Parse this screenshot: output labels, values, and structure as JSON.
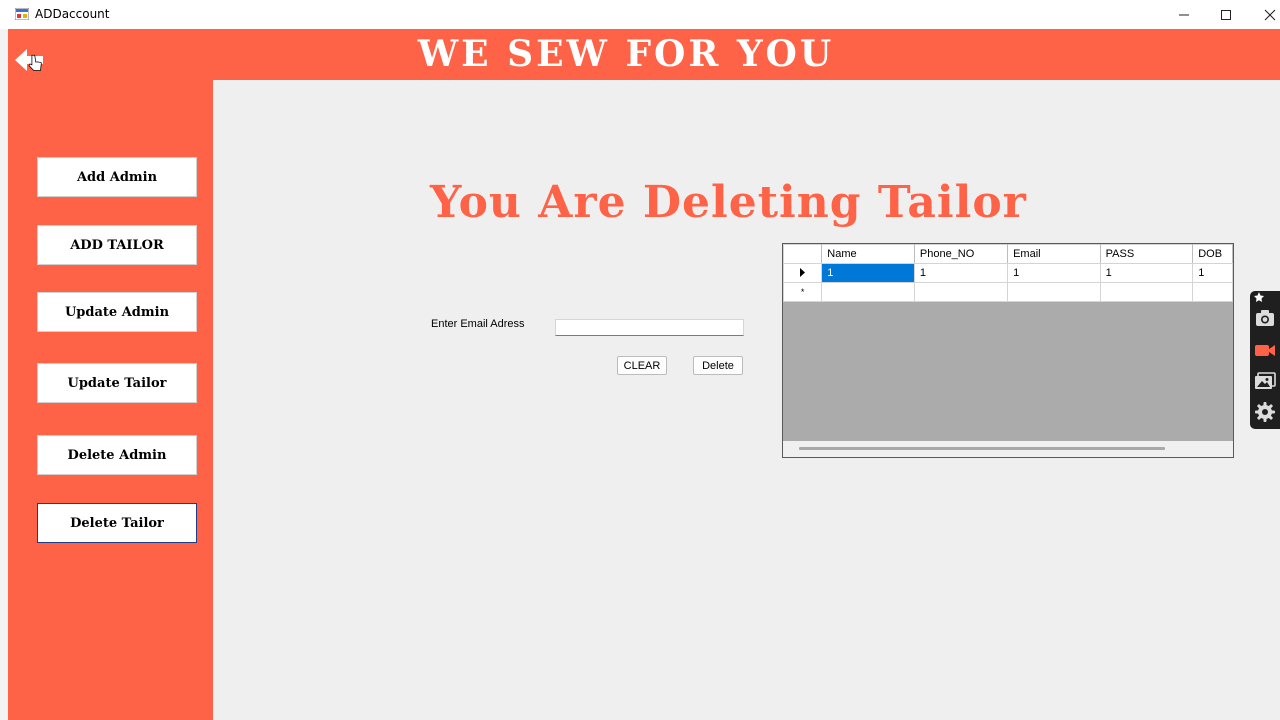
{
  "window": {
    "title": "ADDaccount",
    "controls": [
      "minimize",
      "maximize",
      "close"
    ]
  },
  "header": {
    "brand": "WE SEW FOR YOU",
    "back_icon": "arrow-left-icon"
  },
  "sidebar": {
    "items": [
      {
        "label": "Add Admin"
      },
      {
        "label": "ADD TAILOR"
      },
      {
        "label": "Update Admin"
      },
      {
        "label": "Update Tailor"
      },
      {
        "label": "Delete Admin"
      },
      {
        "label": "Delete Tailor",
        "active": true
      }
    ]
  },
  "main": {
    "heading": "You Are Deleting Tailor",
    "email_label": "Enter Email Adress",
    "email_value": "",
    "clear_label": "CLEAR",
    "delete_label": "Delete"
  },
  "grid": {
    "columns": [
      "Name",
      "Phone_NO",
      "Email",
      "PASS",
      "DOB"
    ],
    "rows": [
      [
        "1",
        "1",
        "1",
        "1",
        "1"
      ]
    ],
    "new_row_marker": "*"
  },
  "floating_toolbar": {
    "icons": [
      "pin-icon",
      "camera-icon",
      "video-icon",
      "gallery-icon",
      "settings-icon"
    ]
  },
  "colors": {
    "accent": "#ff6347",
    "selection": "#0078d7",
    "content_bg": "#efefef"
  }
}
